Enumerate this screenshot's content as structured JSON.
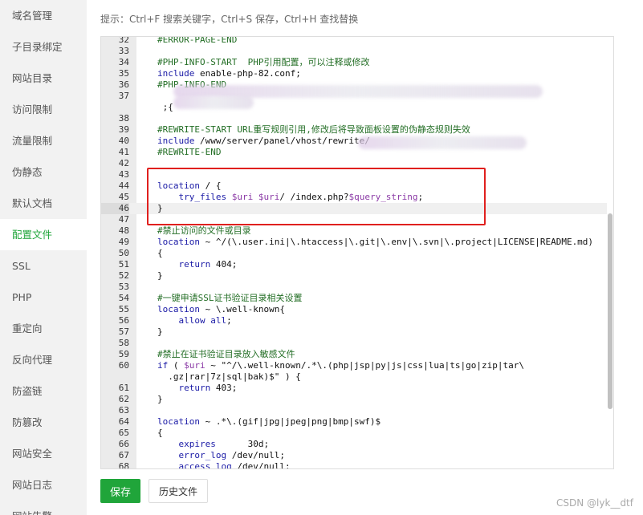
{
  "sidebar": {
    "items": [
      {
        "label": "域名管理",
        "active": false
      },
      {
        "label": "子目录绑定",
        "active": false
      },
      {
        "label": "网站目录",
        "active": false
      },
      {
        "label": "访问限制",
        "active": false
      },
      {
        "label": "流量限制",
        "active": false
      },
      {
        "label": "伪静态",
        "active": false
      },
      {
        "label": "默认文档",
        "active": false
      },
      {
        "label": "配置文件",
        "active": true
      },
      {
        "label": "SSL",
        "active": false
      },
      {
        "label": "PHP",
        "active": false
      },
      {
        "label": "重定向",
        "active": false
      },
      {
        "label": "反向代理",
        "active": false
      },
      {
        "label": "防盗链",
        "active": false
      },
      {
        "label": "防篡改",
        "active": false
      },
      {
        "label": "网站安全",
        "active": false
      },
      {
        "label": "网站日志",
        "active": false
      },
      {
        "label": "网站告警",
        "active": false
      }
    ]
  },
  "hint": "提示：Ctrl+F 搜索关键字，Ctrl+S 保存，Ctrl+H 查找替换",
  "editor": {
    "current_line": "46",
    "lines": [
      {
        "num": "32",
        "text": "    #ERROR-PAGE-END"
      },
      {
        "num": "33",
        "text": ""
      },
      {
        "num": "34",
        "text": "    #PHP-INFO-START  PHP引用配置，可以注释或修改"
      },
      {
        "num": "35",
        "text": "    include enable-php-82.conf;"
      },
      {
        "num": "36",
        "text": "    #PHP-INFO-END"
      },
      {
        "num": "37",
        "text": ""
      },
      {
        "num": "",
        "text": "     ;{"
      },
      {
        "num": "38",
        "text": ""
      },
      {
        "num": "39",
        "text": "    #REWRITE-START URL重写规则引用,修改后将导致面板设置的伪静态规则失效"
      },
      {
        "num": "40",
        "text": "    include /www/server/panel/vhost/rewrite/"
      },
      {
        "num": "41",
        "text": "    #REWRITE-END"
      },
      {
        "num": "42",
        "text": ""
      },
      {
        "num": "43",
        "text": ""
      },
      {
        "num": "44",
        "text": "    location / {"
      },
      {
        "num": "45",
        "text": "        try_files $uri $uri/ /index.php?$query_string;"
      },
      {
        "num": "46",
        "text": "    }"
      },
      {
        "num": "47",
        "text": ""
      },
      {
        "num": "48",
        "text": "    #禁止访问的文件或目录"
      },
      {
        "num": "49",
        "text": "    location ~ ^/(\\.user.ini|\\.htaccess|\\.git|\\.env|\\.svn|\\.project|LICENSE|README.md)"
      },
      {
        "num": "50",
        "text": "    {"
      },
      {
        "num": "51",
        "text": "        return 404;"
      },
      {
        "num": "52",
        "text": "    }"
      },
      {
        "num": "53",
        "text": ""
      },
      {
        "num": "54",
        "text": "    #一键申请SSL证书验证目录相关设置"
      },
      {
        "num": "55",
        "text": "    location ~ \\.well-known{"
      },
      {
        "num": "56",
        "text": "        allow all;"
      },
      {
        "num": "57",
        "text": "    }"
      },
      {
        "num": "58",
        "text": ""
      },
      {
        "num": "59",
        "text": "    #禁止在证书验证目录放入敏感文件"
      },
      {
        "num": "60",
        "text": "    if ( $uri ~ \"^/\\.well-known/.*\\.(php|jsp|py|js|css|lua|ts|go|zip|tar\\"
      },
      {
        "num": "",
        "text": "      .gz|rar|7z|sql|bak)$\" ) {"
      },
      {
        "num": "61",
        "text": "        return 403;"
      },
      {
        "num": "62",
        "text": "    }"
      },
      {
        "num": "63",
        "text": ""
      },
      {
        "num": "64",
        "text": "    location ~ .*\\.(gif|jpg|jpeg|png|bmp|swf)$"
      },
      {
        "num": "65",
        "text": "    {"
      },
      {
        "num": "66",
        "text": "        expires      30d;"
      },
      {
        "num": "67",
        "text": "        error_log /dev/null;"
      },
      {
        "num": "68",
        "text": "        access_log /dev/null;"
      }
    ]
  },
  "buttons": {
    "save": "保存",
    "history": "历史文件"
  },
  "watermark": "CSDN @lyk__dtf",
  "colors": {
    "accent": "#20a53a",
    "highlight_box": "#e0201e",
    "comment": "#236e25",
    "keyword": "#1a1aa6",
    "variable": "#8b3aa6"
  }
}
